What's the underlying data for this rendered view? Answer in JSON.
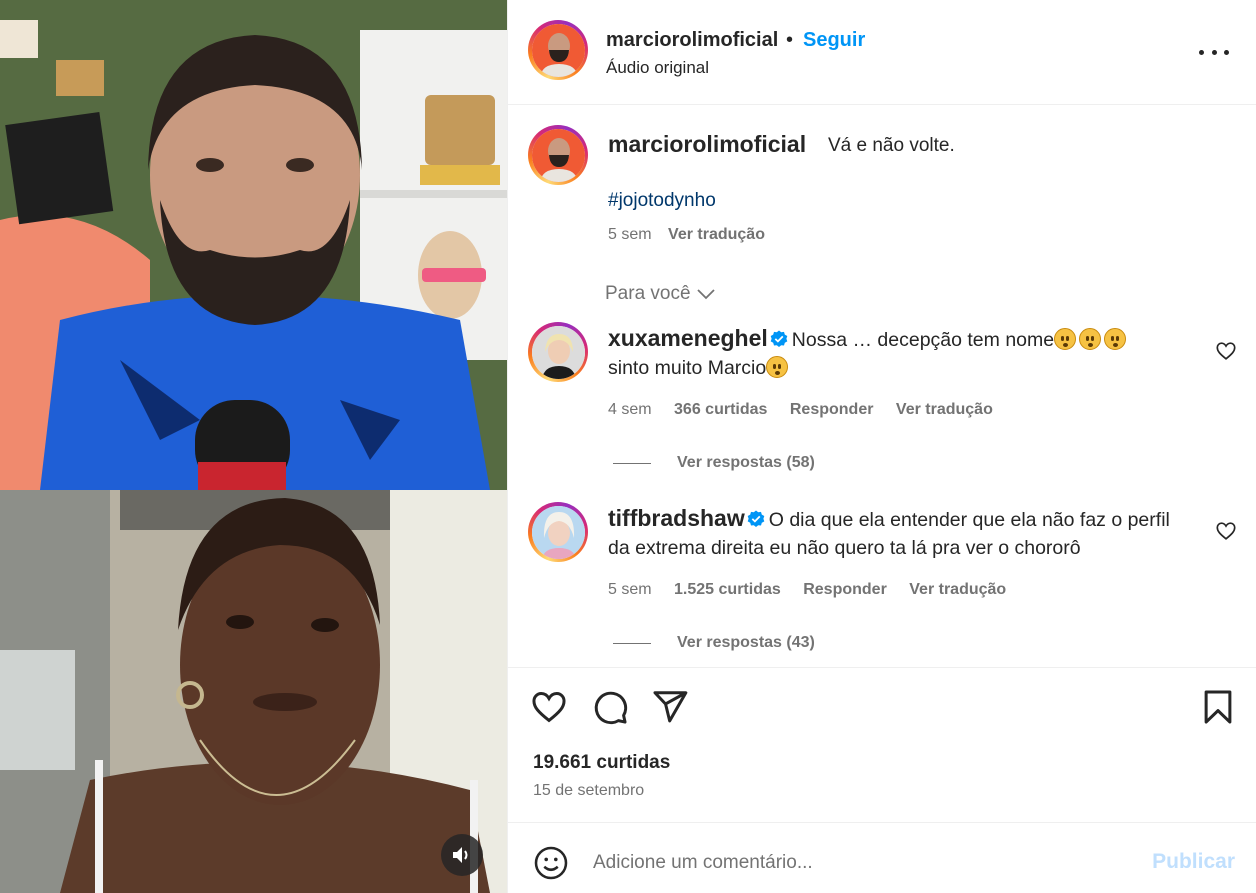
{
  "post": {
    "username": "marciorolimoficial",
    "separator": "•",
    "follow_label": "Seguir",
    "audio_label": "Áudio original",
    "caption_text": "Vá e não volte.",
    "hashtag": "#jojotodynho",
    "caption_age": "5 sem",
    "translate_label": "Ver tradução"
  },
  "for_you_label": "Para você",
  "comments": [
    {
      "username": "xuxameneghel",
      "text_part1": "Nossa … decepção tem nome",
      "text_part2": "sinto muito Marcio",
      "age": "4 sem",
      "likes": "366 curtidas",
      "reply_label": "Responder",
      "translate_label": "Ver tradução",
      "view_replies": "Ver respostas (58)",
      "verified": true
    },
    {
      "username": "tiffbradshaw",
      "text_part1": "O dia que ela entender que ela não faz o perfil da extrema direita eu não quero ta lá pra ver o chororô",
      "text_part2": "",
      "age": "5 sem",
      "likes": "1.525 curtidas",
      "reply_label": "Responder",
      "translate_label": "Ver tradução",
      "view_replies": "Ver respostas (43)",
      "verified": true
    }
  ],
  "actions": {
    "likes_count": "19.661 curtidas",
    "date": "15 de setembro",
    "icons": [
      "heart-icon",
      "comment-icon",
      "share-icon",
      "bookmark-icon"
    ]
  },
  "compose": {
    "placeholder": "Adicione um comentário...",
    "value": "",
    "publish_label": "Publicar"
  },
  "colors": {
    "accent_blue": "#0095f6",
    "hashtag_blue": "#00376b",
    "secondary_text": "#737373",
    "publish_disabled": "#c0dffd",
    "verified_blue": "#0095f6"
  }
}
